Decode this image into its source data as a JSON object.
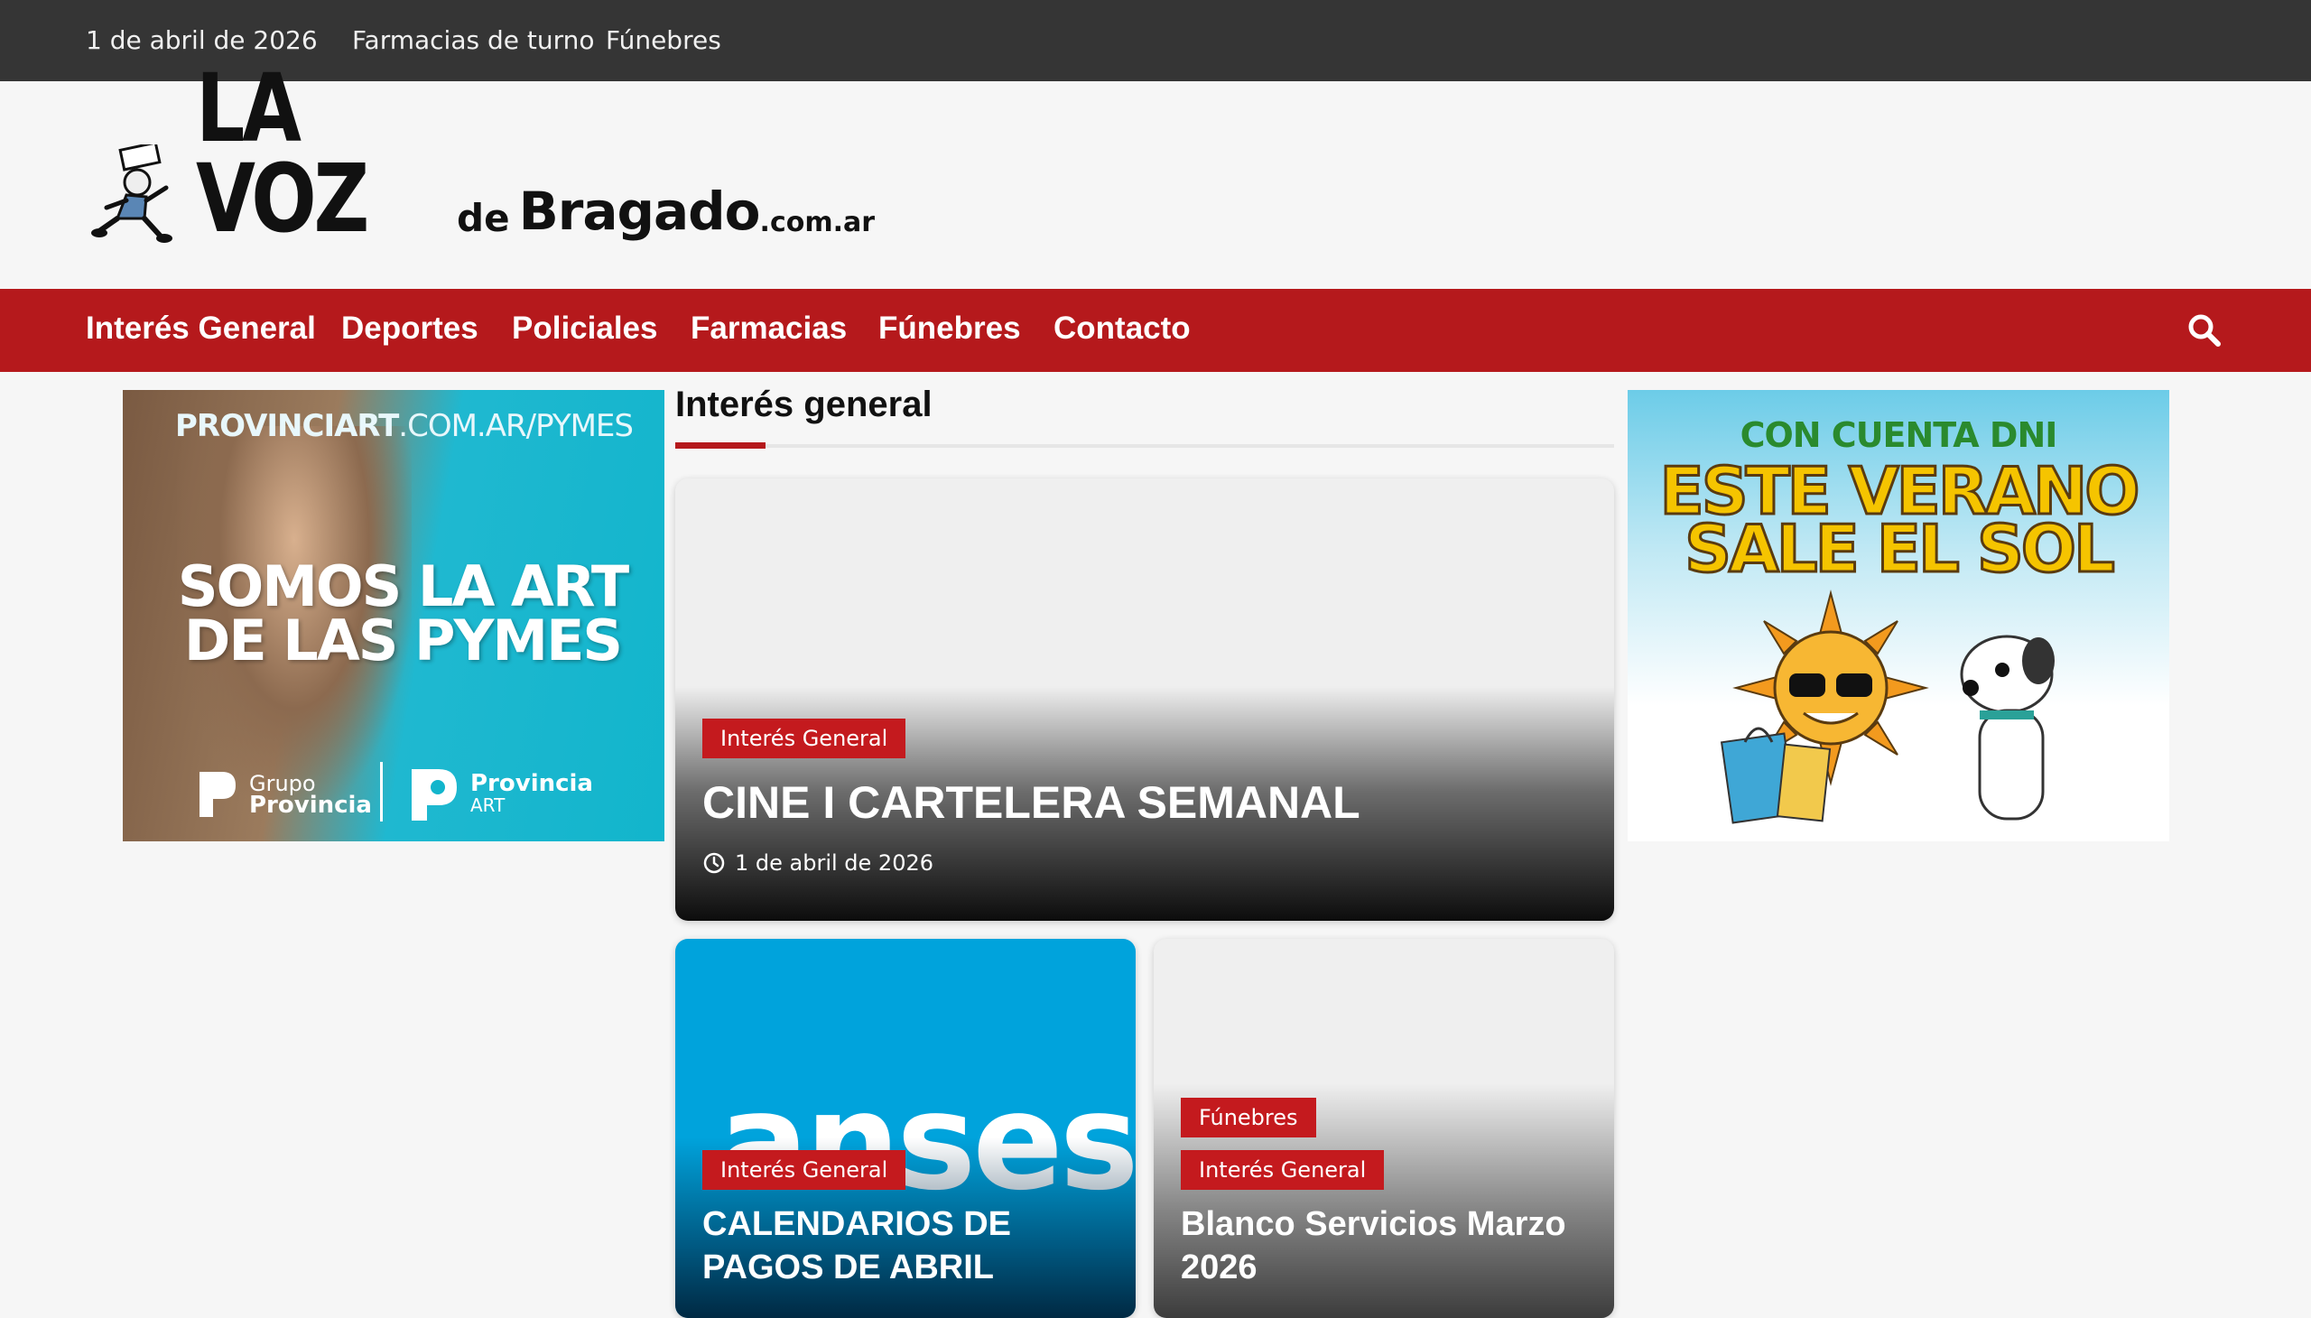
{
  "topbar": {
    "date": "1 de abril de 2026",
    "links": [
      "Farmacias de turno",
      "Fúnebres"
    ]
  },
  "logo": {
    "big": "LA VOZ",
    "de": "de",
    "name": "Bragado",
    "tld": ".com.ar"
  },
  "nav": {
    "items": [
      "Interés General",
      "Deportes",
      "Policiales",
      "Farmacias",
      "Fúnebres",
      "Contacto"
    ],
    "search_icon": "search-icon"
  },
  "ads": {
    "left": {
      "url_bold": "PROVINCIART",
      "url_rest": ".COM.AR/PYMES",
      "slogan_line1": "SOMOS LA ART",
      "slogan_line2": "DE LAS PYMES",
      "brand1_line1": "Grupo",
      "brand1_line2": "Provincia",
      "brand2_line1": "Provincia",
      "brand2_line2": "ART"
    },
    "right": {
      "line1": "CON CUENTA DNI",
      "line2": "ESTE VERANO",
      "line3": "SALE EL SOL"
    }
  },
  "section": {
    "title": "Interés general"
  },
  "cards": {
    "main": {
      "tag": "Interés General",
      "title": "CINE I CARTELERA SEMANAL",
      "date": "1 de abril de 2026"
    },
    "anses": {
      "logo_word": "anses",
      "tag": "Interés General",
      "title_line1": "CALENDARIOS DE",
      "title_line2": "PAGOS DE ABRIL"
    },
    "blanco": {
      "tag1": "Fúnebres",
      "tag2": "Interés General",
      "title_line1": "Blanco Servicios Marzo",
      "title_line2": "2026"
    }
  },
  "colors": {
    "topbar": "#353535",
    "nav": "#b5191c",
    "tag": "#c41a1e",
    "background": "#f6f6f6"
  }
}
